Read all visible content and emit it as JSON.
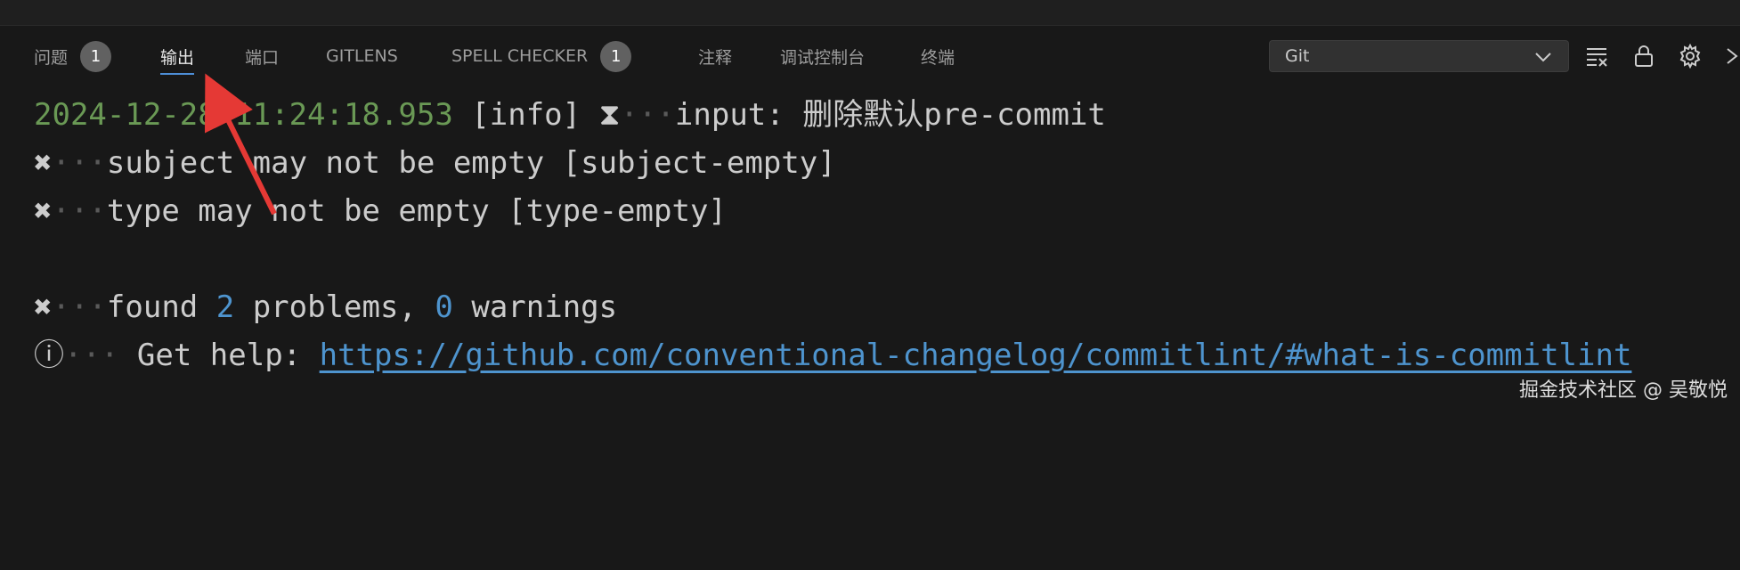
{
  "panel": {
    "tabs": [
      {
        "label": "问题",
        "badge": "1"
      },
      {
        "label": "输出"
      },
      {
        "label": "端口"
      },
      {
        "label": "GITLENS"
      },
      {
        "label": "SPELL CHECKER",
        "badge": "1"
      },
      {
        "label": "注释"
      },
      {
        "label": "调试控制台"
      },
      {
        "label": "终端"
      }
    ],
    "active_tab": "输出",
    "channel_select": {
      "value": "Git"
    },
    "actions": [
      "clear-output-icon",
      "lock-scroll-icon",
      "gear-icon",
      "overflow-icon"
    ]
  },
  "output": {
    "line1": {
      "timestamp": "2024-12-28 11:24:18.953",
      "level": "[info]",
      "symbol": "⧗",
      "dots": "···",
      "text": "input: 删除默认pre-commit"
    },
    "line2": {
      "symbol": "✖",
      "dots": "···",
      "text": "subject may not be empty [subject-empty]"
    },
    "line3": {
      "symbol": "✖",
      "dots": "···",
      "text": "type may not be empty [type-empty]"
    },
    "line4": {
      "symbol": "✖",
      "dots": "···",
      "pre": "found ",
      "count_problems": "2",
      "mid": " problems, ",
      "count_warnings": "0",
      "post": " warnings"
    },
    "line5": {
      "symbol": "ⓘ",
      "dots": "···",
      "pre": "Get help: ",
      "link": "https://github.com/conventional-changelog/commitlint/#what-is-commitlint"
    }
  },
  "watermark": "掘金技术社区 @ 吴敬悦",
  "colors": {
    "background": "#181818",
    "timestamp": "#6a9955",
    "number": "#4e94ce",
    "link": "#4e94ce",
    "active_underline": "#4d8ed6",
    "annotation_arrow": "#e53935"
  }
}
